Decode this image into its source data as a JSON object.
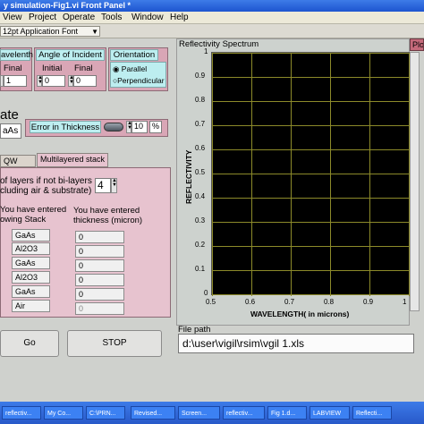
{
  "window": {
    "title": "y simulation-Fig1.vi Front Panel *"
  },
  "menu": [
    "View",
    "Project",
    "Operate",
    "Tools",
    "Window",
    "Help"
  ],
  "toolbar": {
    "font": "12pt Application Font"
  },
  "params": {
    "wavelength": {
      "label": "avelenth",
      "final_label": "Final",
      "final_value": "1"
    },
    "angle": {
      "label": "Angle of Incident",
      "initial_label": "Initial",
      "initial_value": "0",
      "final_label": "Final",
      "final_value": "0"
    },
    "orientation": {
      "label": "Orientation",
      "opt1": "Parallel",
      "opt2": "Perpendicular",
      "selected": "Parallel"
    }
  },
  "substrate": {
    "label": "ate",
    "value": "aAs"
  },
  "thickness_error": {
    "label": "Error in Thickness",
    "value": "10",
    "unit": "%"
  },
  "tabs": {
    "tab1": "QW Stack",
    "tab2": "Multilayered stack"
  },
  "stack": {
    "layers_label1": "of layers if not bi-layers",
    "layers_label2": "cluding air & substrate)",
    "layers_value": "4",
    "entered1": "You have entered",
    "entered2": "owing Stack",
    "thick_label1": "You have entered",
    "thick_label2": "thickness (micron)",
    "materials": [
      "GaAs",
      "Al2O3",
      "GaAs",
      "Al2O3",
      "GaAs",
      "Air"
    ],
    "thicknesses": [
      "0",
      "0",
      "0",
      "0",
      "0",
      "0"
    ]
  },
  "buttons": {
    "go": "Go",
    "stop": "STOP",
    "right_top": "Plo"
  },
  "plot": {
    "title": "Reflectivity Spectrum"
  },
  "file": {
    "label": "File path",
    "path": "d:\\user\\vigil\\rsim\\vgil 1.xls"
  },
  "taskbar": [
    "reflectiv...",
    "My Co...",
    "C:\\PRN...",
    "Revised...",
    "Screen...",
    "reflectiv...",
    "Fig 1.d...",
    "LABVIEW",
    "Reflecti..."
  ],
  "colors": {
    "plot_bg": "#000000",
    "grid": "#8c8a2a",
    "panel_pink": "#d9a6b6",
    "label_cyan": "#bdeef0"
  },
  "chart_data": {
    "type": "line",
    "title": "Reflectivity Spectrum",
    "xlabel": "WAVELENGTH( in microns)",
    "ylabel": "REFLECTIVITY",
    "xlim": [
      0.5,
      1.0
    ],
    "ylim": [
      0,
      1
    ],
    "x_ticks": [
      "0.5",
      "0.6",
      "0.7",
      "0.8",
      "0.9",
      "1"
    ],
    "y_ticks": [
      "0",
      "0.1",
      "0.2",
      "0.3",
      "0.4",
      "0.5",
      "0.6",
      "0.7",
      "0.8",
      "0.9",
      "1"
    ],
    "grid": true,
    "series": []
  }
}
